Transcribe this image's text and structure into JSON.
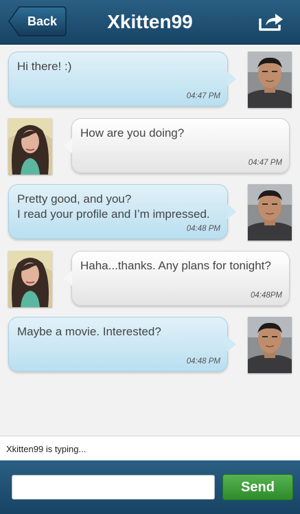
{
  "header": {
    "back_label": "Back",
    "title": "Xkitten99",
    "share_icon": "share-icon"
  },
  "messages": [
    {
      "sender": "me",
      "text": "Hi there! :)",
      "time": "04:47 PM"
    },
    {
      "sender": "them",
      "text": "How are you doing?",
      "time": "04:47 PM"
    },
    {
      "sender": "me",
      "text": "Pretty good, and you?\nI read your profile and I’m impressed.",
      "time": "04:48 PM"
    },
    {
      "sender": "them",
      "text": "Haha...thanks. Any plans for tonight?",
      "time": "04:48PM"
    },
    {
      "sender": "me",
      "text": "Maybe a movie. Interested?",
      "time": "04:48 PM"
    }
  ],
  "status": {
    "typing": "Xkitten99 is typing..."
  },
  "composer": {
    "placeholder": "",
    "send_label": "Send"
  },
  "colors": {
    "header": "#1f4f72",
    "send": "#3b9d37",
    "my_bubble": "#c8e6f4"
  }
}
